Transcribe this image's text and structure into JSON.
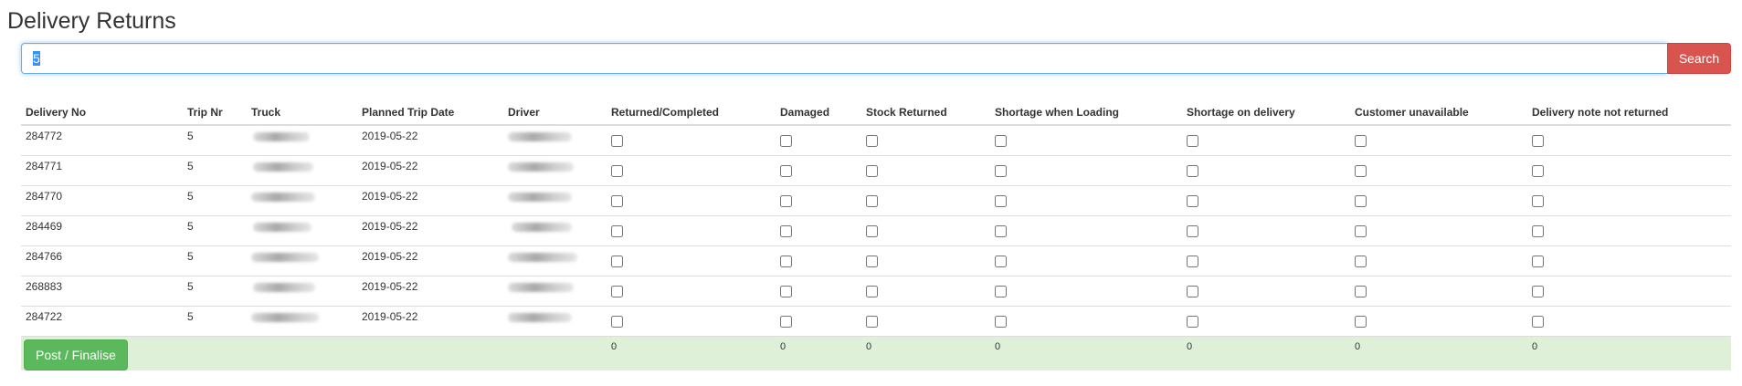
{
  "page": {
    "title": "Delivery Returns"
  },
  "search": {
    "value": "5",
    "button_label": "Search"
  },
  "table": {
    "headers": [
      "Delivery No",
      "Trip Nr",
      "Truck",
      "Planned Trip Date",
      "Driver",
      "Returned/Completed",
      "Damaged",
      "Stock Returned",
      "Shortage when Loading",
      "Shortage on delivery",
      "Customer unavailable",
      "Delivery note not returned"
    ],
    "rows": [
      {
        "delivery_no": "284772",
        "trip_nr": "5",
        "planned_trip_date": "2019-05-22"
      },
      {
        "delivery_no": "284771",
        "trip_nr": "5",
        "planned_trip_date": "2019-05-22"
      },
      {
        "delivery_no": "284770",
        "trip_nr": "5",
        "planned_trip_date": "2019-05-22"
      },
      {
        "delivery_no": "284469",
        "trip_nr": "5",
        "planned_trip_date": "2019-05-22"
      },
      {
        "delivery_no": "284766",
        "trip_nr": "5",
        "planned_trip_date": "2019-05-22"
      },
      {
        "delivery_no": "268883",
        "trip_nr": "5",
        "planned_trip_date": "2019-05-22"
      },
      {
        "delivery_no": "284722",
        "trip_nr": "5",
        "planned_trip_date": "2019-05-22"
      }
    ],
    "totals": {
      "returned_completed": "0",
      "damaged": "0",
      "stock_returned": "0",
      "shortage_when_loading": "0",
      "shortage_on_delivery": "0",
      "customer_unavailable": "0",
      "delivery_note_not_returned": "0"
    }
  },
  "footer": {
    "post_button_label": "Post / Finalise"
  },
  "colors": {
    "search_button": "#d9534f",
    "post_button": "#5cb85c",
    "footer_row": "#dff0d8",
    "input_focus": "#66afe9"
  }
}
